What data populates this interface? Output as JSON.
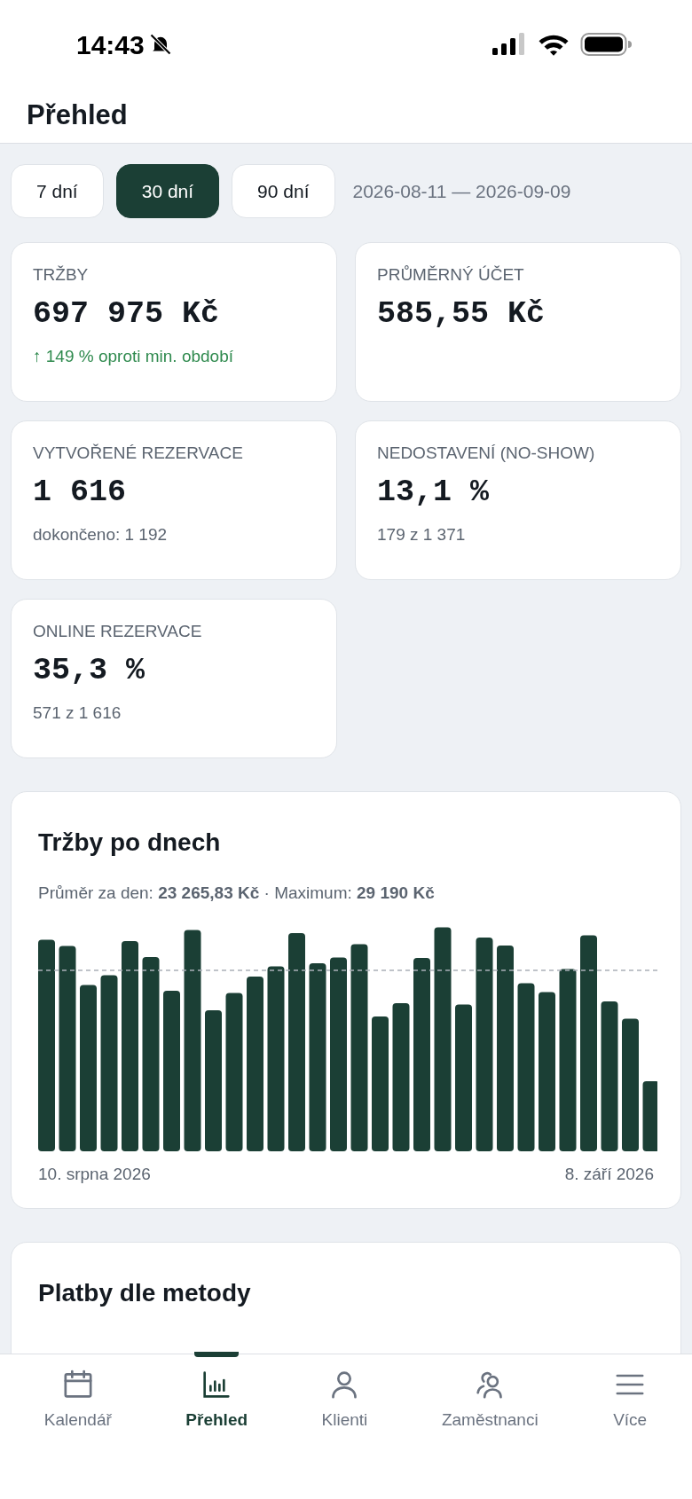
{
  "status_bar": {
    "time": "14:43"
  },
  "header": {
    "title": "Přehled"
  },
  "periods": [
    {
      "label": "7 dní",
      "selected": false
    },
    {
      "label": "30 dní",
      "selected": true
    },
    {
      "label": "90 dní",
      "selected": false
    }
  ],
  "date_range": "2026-08-11 — 2026-09-09",
  "metrics": [
    {
      "label": "TRŽBY",
      "value": "697 975 Kč",
      "sub": "↑ 149 % oproti min. období",
      "kind": "trend"
    },
    {
      "label": "PRŮMĚRNÝ ÚČET",
      "value": "585,55 Kč"
    },
    {
      "label": "VYTVOŘENÉ REZERVACE",
      "value": "1 616",
      "sub": "dokončeno: 1 192",
      "kind": "note"
    },
    {
      "label": "NEDOSTAVENÍ (NO-SHOW)",
      "value": "13,1 %",
      "sub": "179 z 1 371",
      "kind": "note"
    },
    {
      "label": "ONLINE REZERVACE",
      "value": "35,3 %",
      "sub": "571 z 1 616",
      "kind": "note"
    }
  ],
  "daily_chart": {
    "title": "Tržby po dnech",
    "summary": "Průměr za den: **23 265,83 Kč** · Maximum: **29 190 Kč**",
    "start_label": "10. srpna 2026",
    "end_label": "8. září 2026"
  },
  "payments": {
    "title": "Platby dle metody"
  },
  "bottom_nav": [
    {
      "label": "Kalendář",
      "selected": false
    },
    {
      "label": "Přehled",
      "selected": true
    },
    {
      "label": "Klienti",
      "selected": false
    },
    {
      "label": "Zaměstnanci",
      "selected": false
    },
    {
      "label": "Více",
      "selected": false
    }
  ]
}
